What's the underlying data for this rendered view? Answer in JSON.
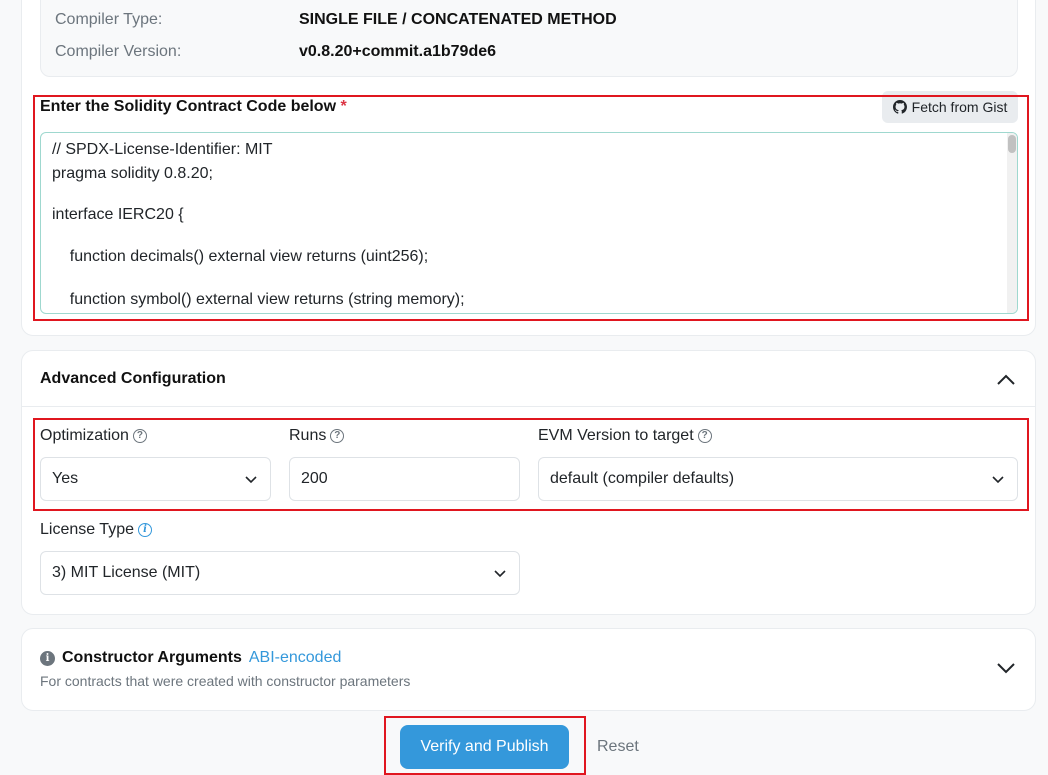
{
  "compiler_info": {
    "type_label": "Compiler Type:",
    "type_value": "SINGLE FILE / CONCATENATED METHOD",
    "version_label": "Compiler Version:",
    "version_value": "v0.8.20+commit.a1b79de6"
  },
  "code_section": {
    "title": "Enter the Solidity Contract Code below",
    "required_mark": "*",
    "gist_button": "Fetch from Gist",
    "gist_icon": "github-icon",
    "code_lines": [
      "// SPDX-License-Identifier: MIT",
      "pragma solidity 0.8.20;",
      "interface IERC20 {",
      "    function decimals() external view returns (uint256);",
      "    function symbol() external view returns (string memory);"
    ]
  },
  "advanced": {
    "title": "Advanced Configuration",
    "toggle_icon": "chevron-up-icon",
    "optimization": {
      "label": "Optimization",
      "value": "Yes"
    },
    "runs": {
      "label": "Runs",
      "value": "200"
    },
    "evm": {
      "label": "EVM Version to target",
      "value": "default (compiler defaults)"
    },
    "license": {
      "label": "License Type",
      "value": "3) MIT License (MIT)"
    }
  },
  "constructor": {
    "title": "Constructor Arguments",
    "badge": "ABI-encoded",
    "subtitle": "For contracts that were created with constructor parameters",
    "toggle_icon": "chevron-down-icon"
  },
  "actions": {
    "verify_label": "Verify and Publish",
    "reset_label": "Reset"
  },
  "colors": {
    "primary": "#3498db",
    "highlight": "#e0161f",
    "required": "#dc3545",
    "textarea_border": "#9fd8cf"
  }
}
